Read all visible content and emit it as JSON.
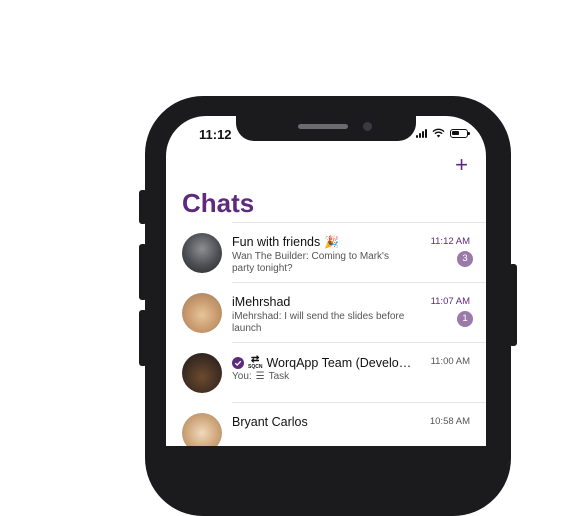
{
  "status": {
    "time": "11:12"
  },
  "header": {
    "title": "Chats",
    "add_symbol": "+"
  },
  "chats": [
    {
      "name": "Fun with friends",
      "emoji": "🎉",
      "preview": "Wan The Builder: Coming to Mark's party tonight?",
      "time": "11:12 AM",
      "unread": "3"
    },
    {
      "name": "iMehrshad",
      "preview": "iMehrshad: I will send the slides before launch",
      "time": "11:07 AM",
      "unread": "1"
    },
    {
      "name": "WorqApp Team (Developme...",
      "prefix_icon_text": "SQCN",
      "preview_sender": "You:",
      "preview": "Task",
      "time": "11:00 AM"
    },
    {
      "name": "Bryant Carlos",
      "time": "10:58 AM"
    }
  ],
  "colors": {
    "accent": "#5e2a7d",
    "badge": "#9b7aa9",
    "phone_frame": "#1b1b1d"
  }
}
